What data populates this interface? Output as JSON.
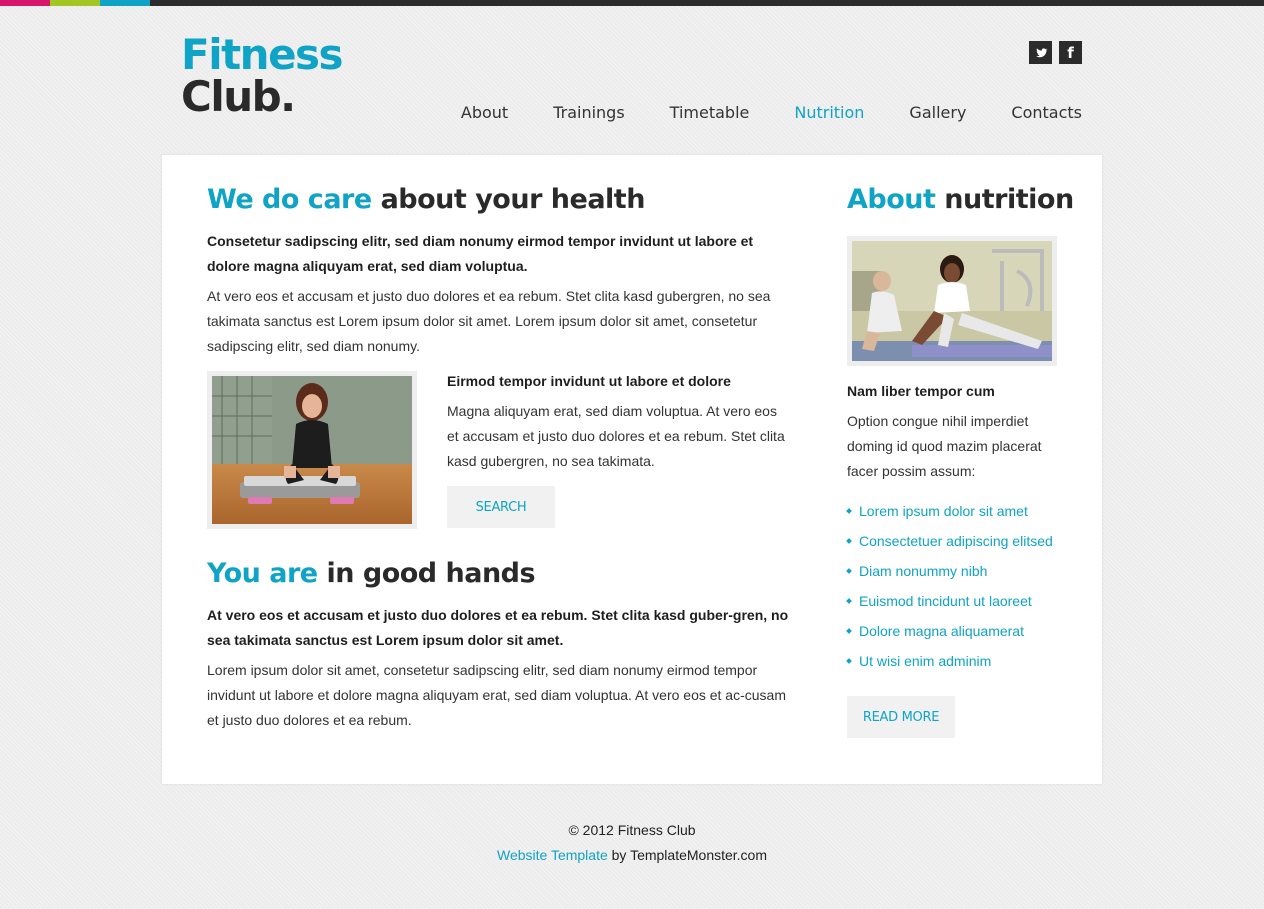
{
  "colors": {
    "accent": "#0fa3c6",
    "bar_pink": "#d6156b",
    "bar_green": "#a3c623",
    "bar_blue": "#0fa3c6"
  },
  "logo": {
    "line1": "Fitness",
    "line2": "Club."
  },
  "social": [
    {
      "name": "twitter-icon",
      "glyph": ""
    },
    {
      "name": "facebook-icon",
      "glyph": "f"
    }
  ],
  "nav": [
    {
      "label": "About",
      "active": false
    },
    {
      "label": "Trainings",
      "active": false
    },
    {
      "label": "Timetable",
      "active": false
    },
    {
      "label": "Nutrition",
      "active": true
    },
    {
      "label": "Gallery",
      "active": false
    },
    {
      "label": "Contacts",
      "active": false
    }
  ],
  "main": {
    "section1": {
      "title_accent": "We do care",
      "title_rest": " about your health",
      "lead": "Consetetur sadipscing elitr, sed diam nonumy eirmod tempor invidunt ut labore et dolore magna aliquyam erat, sed diam voluptua.",
      "text": "At vero eos et accusam et justo duo dolores et ea rebum. Stet clita kasd gubergren, no sea takimata sanctus est Lorem ipsum dolor sit amet. Lorem ipsum dolor sit amet, consetetur sadipscing elitr, sed diam nonumy.",
      "sub_title": "Eirmod tempor invidunt ut labore et dolore",
      "sub_text": "Magna aliquyam erat, sed diam voluptua. At vero eos et accusam et justo duo dolores et ea rebum. Stet clita kasd gubergren, no sea takimata.",
      "button": "Search"
    },
    "section2": {
      "title_accent": "You are",
      "title_rest": " in good hands",
      "lead": "At vero eos et accusam et justo duo dolores et ea rebum. Stet clita kasd guber-gren, no sea takimata sanctus est Lorem ipsum dolor sit amet.",
      "text": "Lorem ipsum dolor sit amet, consetetur sadipscing elitr, sed diam nonumy eirmod tempor invidunt ut labore et dolore magna aliquyam erat, sed diam voluptua. At vero eos et ac-cusam et justo duo dolores et ea rebum."
    }
  },
  "sidebar": {
    "title_accent": "About",
    "title_rest": " nutrition",
    "sub_title": "Nam liber tempor cum",
    "text": "Option congue nihil imperdiet doming id quod mazim placerat facer possim assum:",
    "links": [
      "Lorem ipsum dolor sit amet",
      "Consectetuer adipiscing elitsed",
      "Diam nonummy nibh",
      "Euismod tincidunt ut laoreet",
      "Dolore magna aliquamerat",
      "Ut wisi enim adminim"
    ],
    "button": "Read more"
  },
  "footer": {
    "copyright": "© 2012 Fitness Club",
    "link": "Website Template",
    "by": " by TemplateMonster.com"
  }
}
